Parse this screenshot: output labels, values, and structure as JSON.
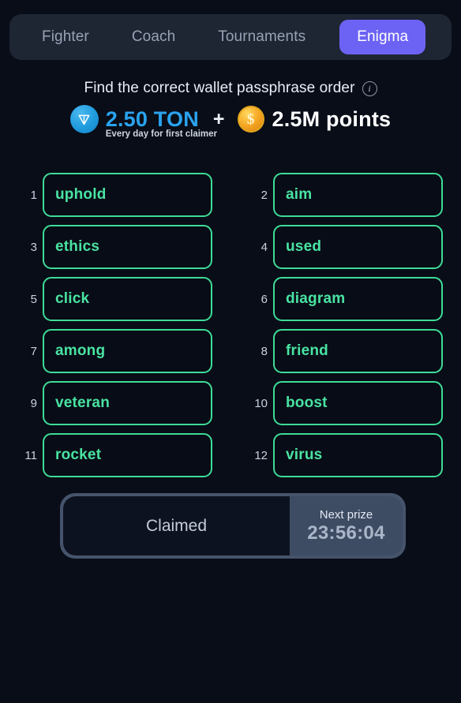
{
  "nav": {
    "tabs": [
      {
        "label": "Fighter",
        "active": false
      },
      {
        "label": "Coach",
        "active": false
      },
      {
        "label": "Tournaments",
        "active": false
      },
      {
        "label": "Enigma",
        "active": true
      }
    ]
  },
  "header": {
    "title": "Find the correct wallet passphrase order",
    "info_icon": "info-icon",
    "info_glyph": "i"
  },
  "prize": {
    "ton_icon": "ton-logo-icon",
    "ton_glyph": "▽",
    "ton_amount": "2.50 TON",
    "ton_note": "Every day for first claimer",
    "separator": "+",
    "coin_icon": "coin-icon",
    "coin_glyph": "$",
    "points_amount": "2.5M points"
  },
  "puzzle": {
    "words": [
      {
        "num": "1",
        "word": "uphold"
      },
      {
        "num": "2",
        "word": "aim"
      },
      {
        "num": "3",
        "word": "ethics"
      },
      {
        "num": "4",
        "word": "used"
      },
      {
        "num": "5",
        "word": "click"
      },
      {
        "num": "6",
        "word": "diagram"
      },
      {
        "num": "7",
        "word": "among"
      },
      {
        "num": "8",
        "word": "friend"
      },
      {
        "num": "9",
        "word": "veteran"
      },
      {
        "num": "10",
        "word": "boost"
      },
      {
        "num": "11",
        "word": "rocket"
      },
      {
        "num": "12",
        "word": "virus"
      }
    ]
  },
  "claim": {
    "status_label": "Claimed",
    "next_prize_label": "Next prize",
    "next_prize_time": "23:56:04"
  },
  "colors": {
    "page_bg": "#090d18",
    "nav_bg": "#1e2634",
    "accent_active_tab": "#6c63f5",
    "tile_border": "#3ddc97",
    "tile_text": "#49e3a2",
    "ton_blue": "#2aa3ef",
    "coin_orange": "#f5a623",
    "claim_bar_frame": "#46546b",
    "claim_right_bg": "#3e4c63"
  }
}
